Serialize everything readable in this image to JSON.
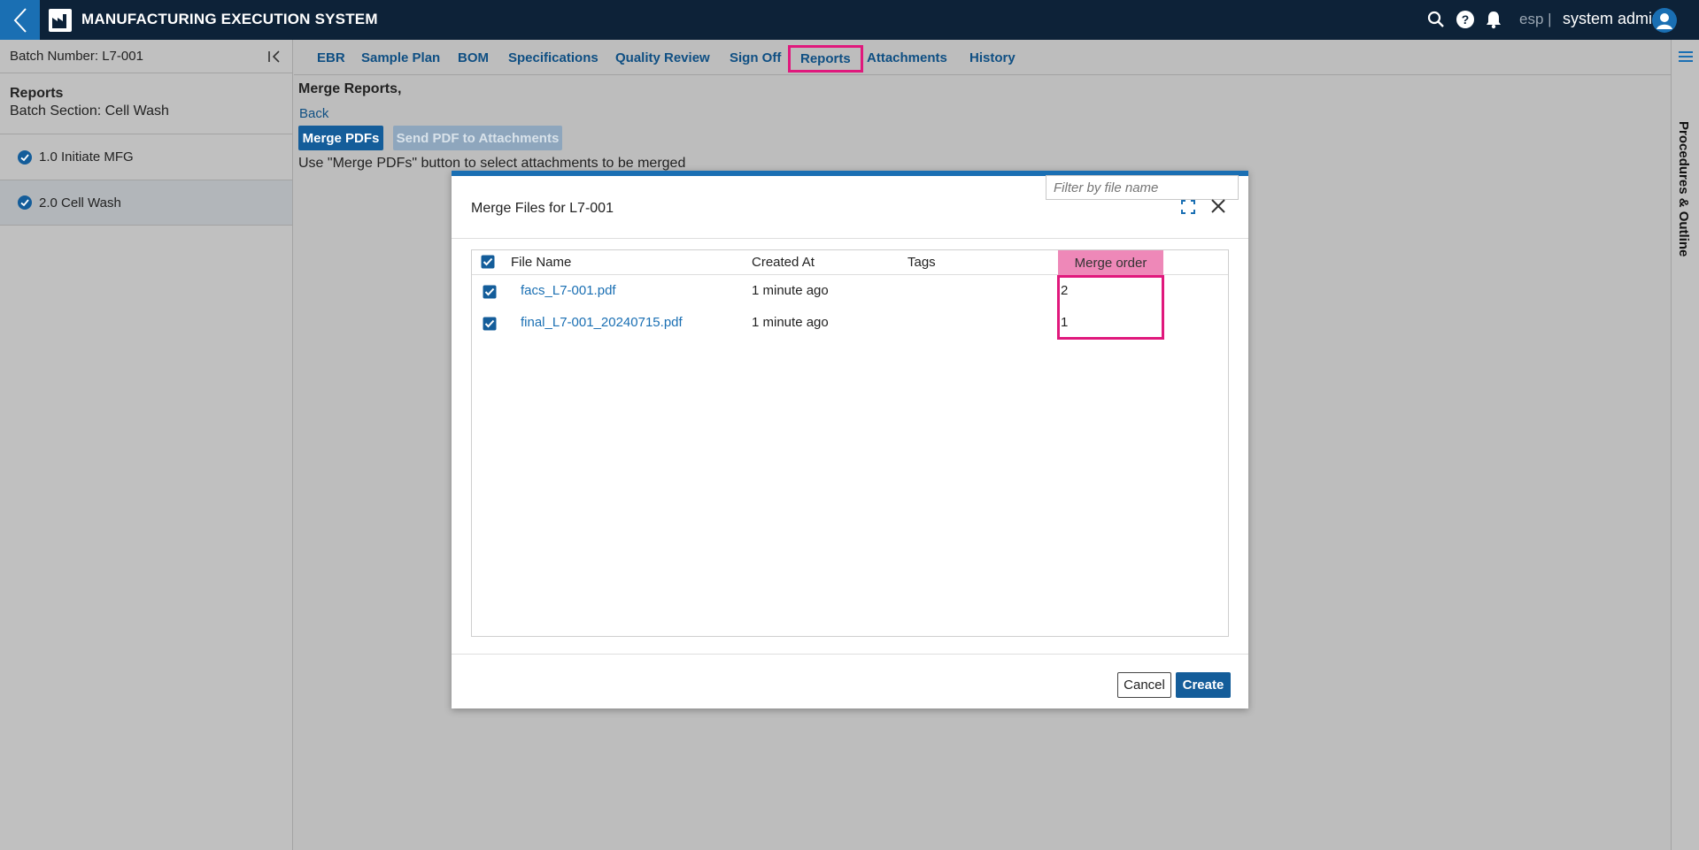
{
  "app": {
    "title": "MANUFACTURING EXECUTION SYSTEM",
    "tenant": "esp |",
    "user": "system admin",
    "brand_color": "#0d2238",
    "accent_color": "#1a6fb3",
    "highlight_color": "#e0187c"
  },
  "left_panel": {
    "batch_label": "Batch Number: L7-001",
    "section_title": "Reports",
    "section_subtitle": "Batch Section: Cell Wash",
    "items": [
      {
        "label": "1.0 Initiate MFG",
        "complete": true,
        "active": false
      },
      {
        "label": "2.0 Cell Wash",
        "complete": true,
        "active": true
      }
    ]
  },
  "tabs": [
    {
      "label": "EBR"
    },
    {
      "label": "Sample Plan"
    },
    {
      "label": "BOM"
    },
    {
      "label": "Specifications"
    },
    {
      "label": "Quality Review"
    },
    {
      "label": "Sign Off"
    },
    {
      "label": "Reports",
      "highlighted": true
    },
    {
      "label": "Attachments"
    },
    {
      "label": "History"
    }
  ],
  "right_rail": {
    "label": "Procedures & Outline"
  },
  "content": {
    "heading": "Merge Reports,",
    "back_link": "Back",
    "merge_button": "Merge PDFs",
    "send_button": "Send PDF to Attachments",
    "hint": "Use \"Merge PDFs\" button to select attachments to be merged"
  },
  "modal": {
    "title": "Merge Files for L7-001",
    "filter_placeholder": "Filter by file name",
    "columns": {
      "file_name": "File Name",
      "created_at": "Created At",
      "tags": "Tags",
      "merge_order": "Merge order"
    },
    "rows": [
      {
        "file_name": "facs_L7-001.pdf",
        "created_at": "1 minute ago",
        "tags": "",
        "merge_order": "2",
        "checked": true
      },
      {
        "file_name": "final_L7-001_20240715.pdf",
        "created_at": "1 minute ago",
        "tags": "",
        "merge_order": "1",
        "checked": true
      }
    ],
    "cancel_label": "Cancel",
    "create_label": "Create"
  }
}
